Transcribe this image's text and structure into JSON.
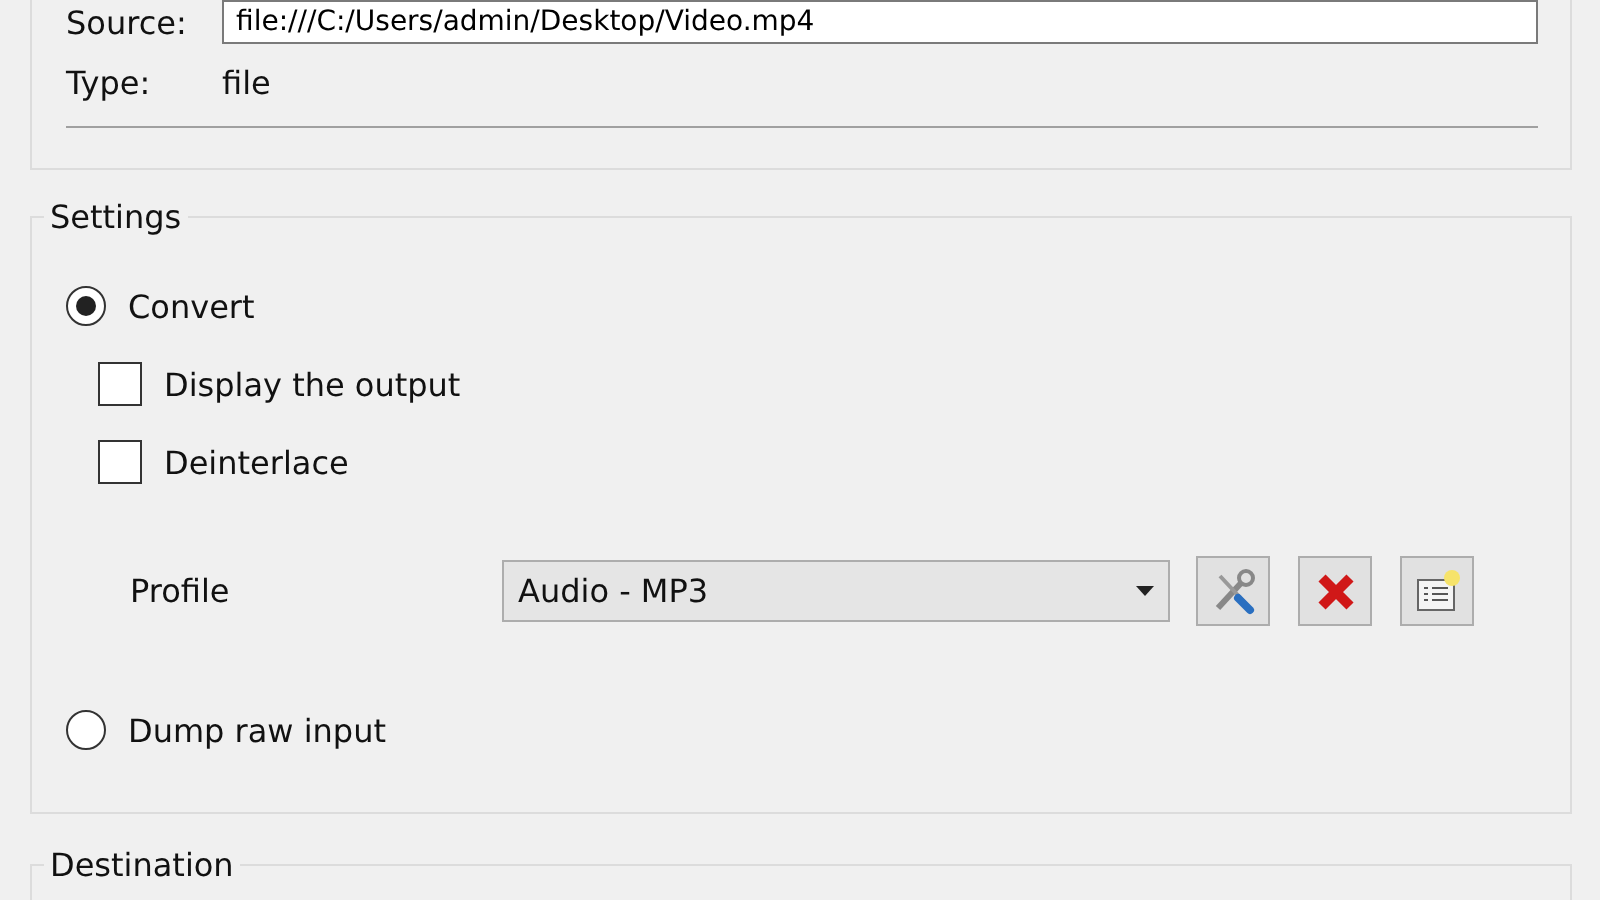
{
  "source": {
    "label": "Source:",
    "value": "file:///C:/Users/admin/Desktop/Video.mp4"
  },
  "type": {
    "label": "Type:",
    "value": "file"
  },
  "settings": {
    "title": "Settings",
    "modes": [
      {
        "label": "Convert",
        "selected": true
      },
      {
        "label": "Dump raw input",
        "selected": false
      }
    ],
    "options": [
      {
        "label": "Display the output",
        "checked": false
      },
      {
        "label": "Deinterlace",
        "checked": false
      }
    ],
    "profile": {
      "label": "Profile",
      "value": "Audio - MP3"
    }
  },
  "destination": {
    "title": "Destination"
  }
}
